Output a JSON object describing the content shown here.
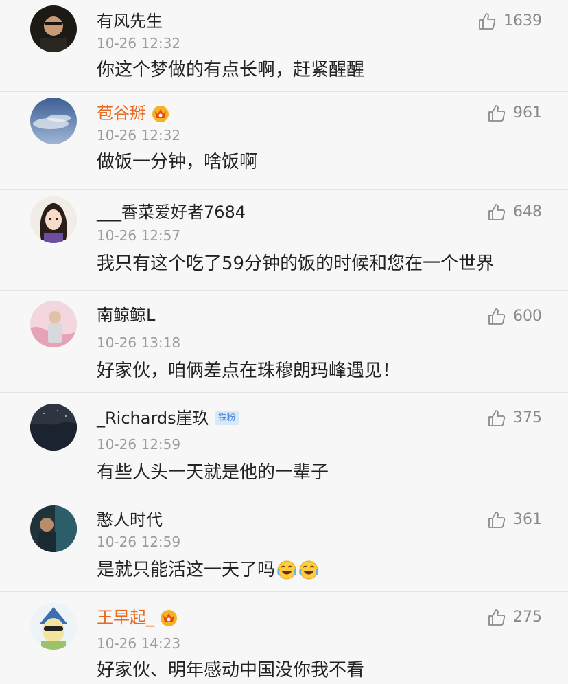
{
  "comments": [
    {
      "name": "有风先生",
      "time": "10-26 12:32",
      "text": "你这个梦做的有点长啊，赶紧醒醒",
      "likes": "1639"
    },
    {
      "name": "苞谷掰",
      "time": "10-26 12:32",
      "text": "做饭一分钟，啥饭啊",
      "likes": "961"
    },
    {
      "name": "___香菜爱好者7684",
      "time": "10-26 12:57",
      "text": "我只有这个吃了59分钟的饭的时候和您在一个世界",
      "likes": "648"
    },
    {
      "name": "南鲸鲸L",
      "time": "10-26 13:18",
      "text": "好家伙，咱俩差点在珠穆朗玛峰遇见！",
      "likes": "600"
    },
    {
      "name": "_Richards崖玖",
      "badge": "铁粉",
      "time": "10-26 12:59",
      "text": "有些人头一天就是他的一辈子",
      "likes": "375"
    },
    {
      "name": "憨人时代",
      "time": "10-26 12:59",
      "text": "是就只能活这一天了吗",
      "likes": "361"
    },
    {
      "name": "王早起_",
      "time": "10-26 14:23",
      "text": "好家伙、明年感动中国没你我不看",
      "likes": "275"
    }
  ],
  "colors": {
    "vip_name": "#ea6a1f",
    "time": "#9b9b9b",
    "like": "#8a8a8a",
    "divider": "#e3e3e3",
    "background": "#f7f7f7"
  },
  "icons": {
    "like": "thumbs-up-icon",
    "vip": "crown-badge-icon",
    "emoji": "laugh-cry-emoji-icon"
  }
}
